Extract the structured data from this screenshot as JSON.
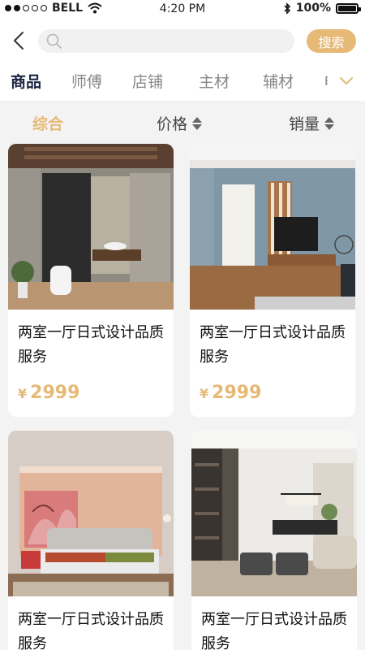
{
  "status_bar": {
    "carrier": "BELL",
    "time": "4:20 PM",
    "battery": "100%"
  },
  "header": {
    "search_placeholder": "",
    "search_button": "搜索"
  },
  "tabs": [
    "商品",
    "师傅",
    "店铺",
    "主材",
    "辅材",
    "电"
  ],
  "active_tab": "商品",
  "sort": {
    "comprehensive": "综合",
    "price": "价格",
    "sales": "销量"
  },
  "products": [
    {
      "title": "两室一厅日式设计品质服务",
      "currency": "¥",
      "price": "2999"
    },
    {
      "title": "两室一厅日式设计品质服务",
      "currency": "¥",
      "price": "2999"
    },
    {
      "title": "两室一厅日式设计品质服务",
      "currency": "¥",
      "price": ""
    },
    {
      "title": "两室一厅日式设计品质服务",
      "currency": "¥",
      "price": ""
    }
  ],
  "colors": {
    "accent": "#e6b977",
    "active_tab": "#1c2541"
  },
  "icons": [
    "signal-dots-icon",
    "wifi-icon",
    "bluetooth-icon",
    "battery-icon",
    "back-arrow-icon",
    "search-icon",
    "chevron-down-icon",
    "sort-arrows-icon"
  ]
}
